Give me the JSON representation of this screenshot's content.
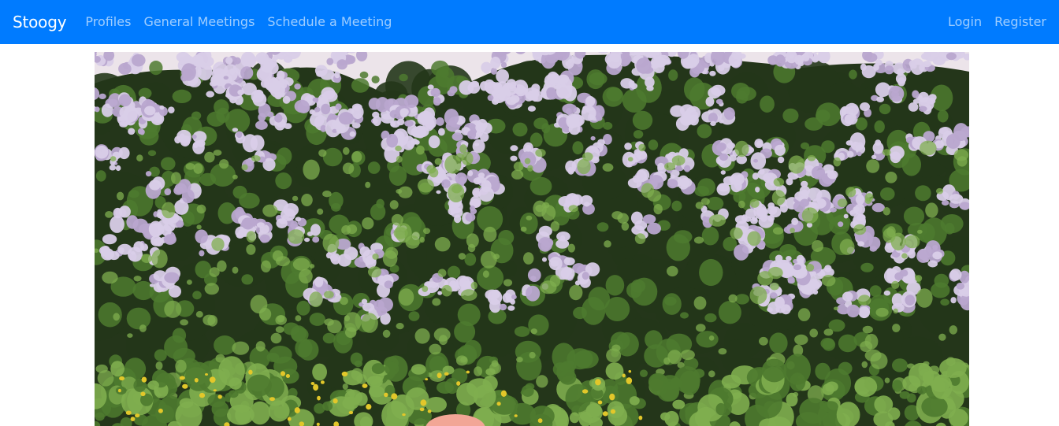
{
  "navbar": {
    "brand": "Stoogy",
    "links": [
      {
        "label": "Profiles"
      },
      {
        "label": "General Meetings"
      },
      {
        "label": "Schedule a Meeting"
      }
    ],
    "auth": [
      {
        "label": "Login"
      },
      {
        "label": "Register"
      }
    ],
    "background_color": "#007bff"
  },
  "hero": {
    "image_subject": "lilac-bushes-photo",
    "colors": {
      "sky": "#ece4ea",
      "foliage_dark": "#24361a",
      "foliage_mid": "#4e7a2f",
      "foliage_light": "#7fae4f",
      "blossom": "#d9cde8",
      "blossom_shade": "#b9a7cf",
      "flower_yellow": "#e2c72a",
      "pink_object": "#f2a696"
    }
  }
}
